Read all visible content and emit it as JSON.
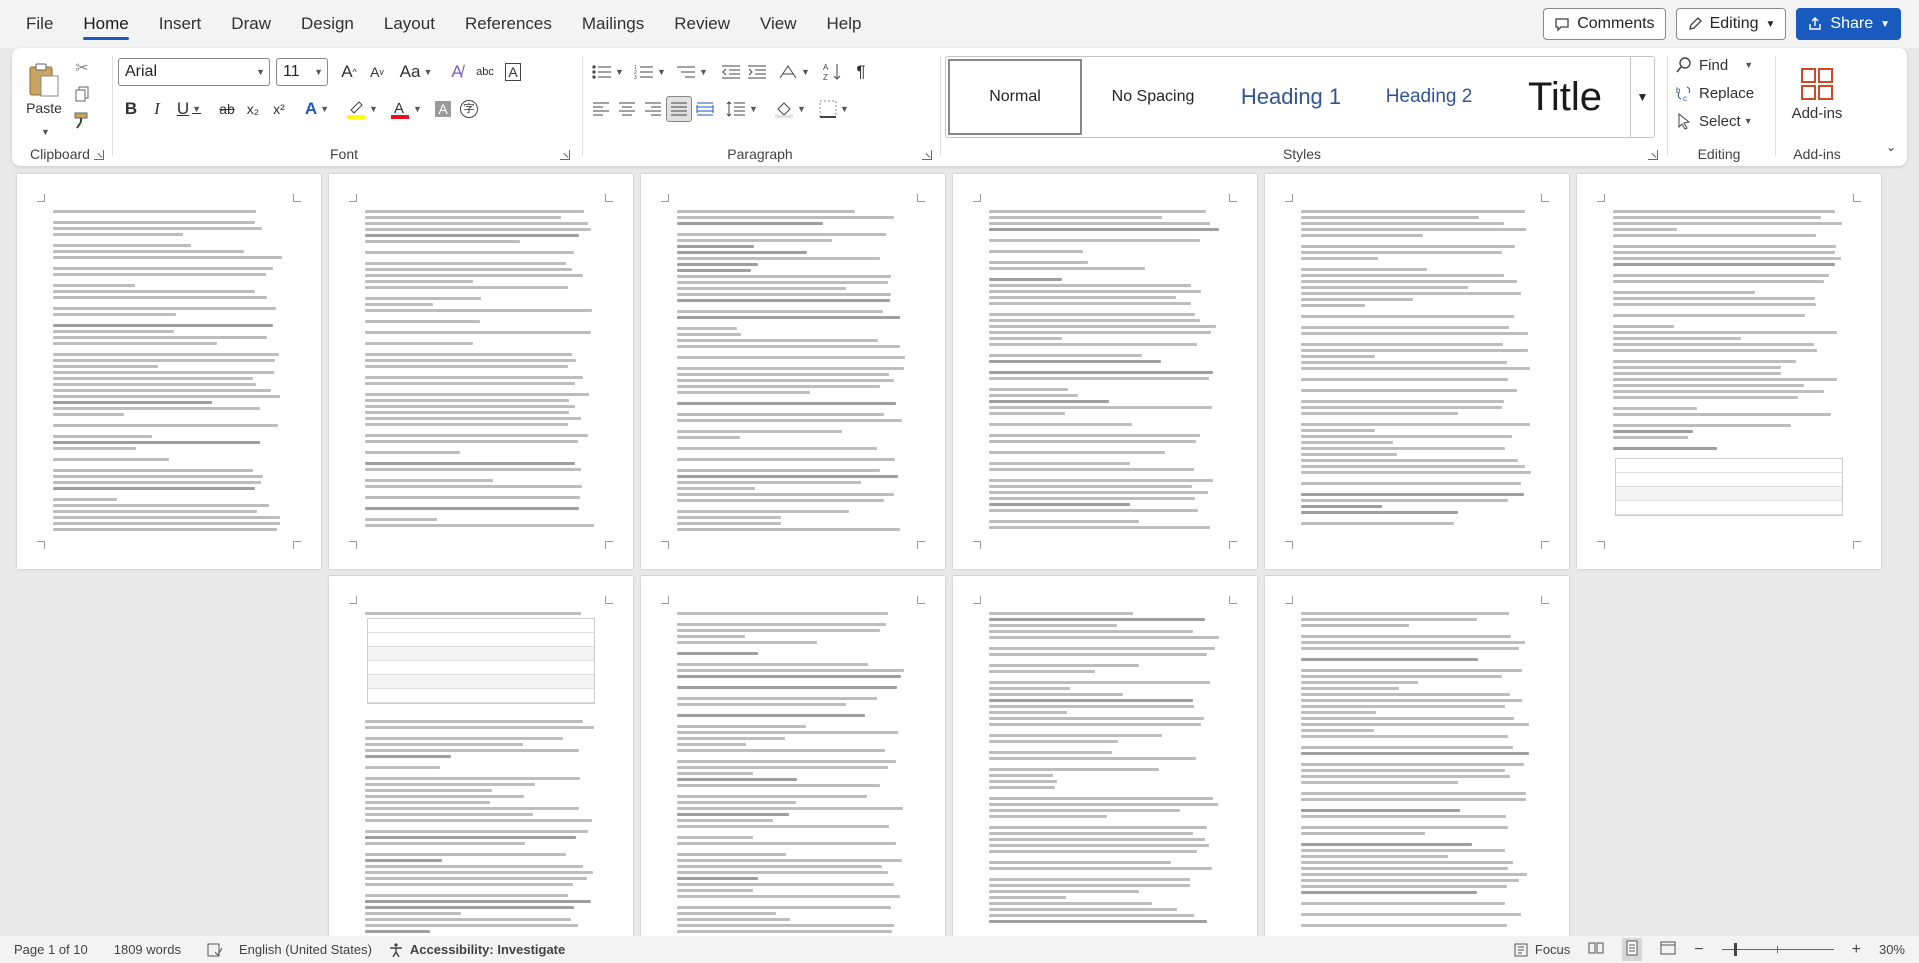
{
  "menu": {
    "tabs": [
      "File",
      "Home",
      "Insert",
      "Draw",
      "Design",
      "Layout",
      "References",
      "Mailings",
      "Review",
      "View",
      "Help"
    ],
    "active": "Home"
  },
  "topright": {
    "comments": "Comments",
    "editing": "Editing",
    "share": "Share"
  },
  "ribbon": {
    "clipboard": {
      "paste": "Paste",
      "label": "Clipboard"
    },
    "font": {
      "name": "Arial",
      "size": "11",
      "label": "Font",
      "buttons": [
        "B",
        "I",
        "U",
        "ab",
        "x₂",
        "x²",
        "A",
        "Aa"
      ]
    },
    "paragraph": {
      "label": "Paragraph"
    },
    "styles": {
      "label": "Styles",
      "items": [
        "Normal",
        "No Spacing",
        "Heading 1",
        "Heading 2",
        "Title"
      ]
    },
    "editing": {
      "label": "Editing",
      "find": "Find",
      "replace": "Replace",
      "select": "Select"
    },
    "addins": {
      "label": "Add-ins",
      "button": "Add-ins"
    }
  },
  "colors": {
    "accent": "#185abd",
    "heading": "#2f5597",
    "highlight": "#ffff00",
    "font_color": "#e81123"
  },
  "status": {
    "page": "Page 1 of 10",
    "words": "1809 words",
    "language": "English (United States)",
    "accessibility": "Accessibility: Investigate",
    "focus": "Focus",
    "zoom": "30%"
  }
}
